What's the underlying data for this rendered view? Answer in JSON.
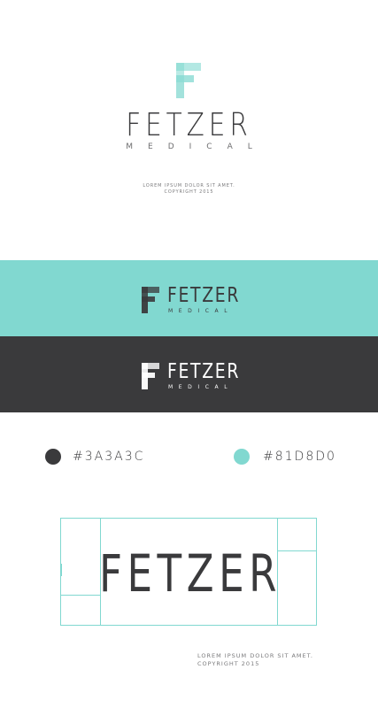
{
  "brand": {
    "name": "FETZER",
    "tagline": "MEDICAL",
    "copyright_line1": "LOREM IPSUM DOLOR SIT AMET.",
    "copyright_line2": "COPYRIGHT 2015"
  },
  "colors": {
    "dark": "#3a3a3c",
    "teal": "#81d8d0",
    "teal_light": "#c9eeea",
    "white": "#ffffff"
  },
  "palette": [
    {
      "hex_label": "#3A3A3C"
    },
    {
      "hex_label": "#81D8D0"
    }
  ],
  "icons": {
    "monogram": "f-monogram-icon"
  }
}
